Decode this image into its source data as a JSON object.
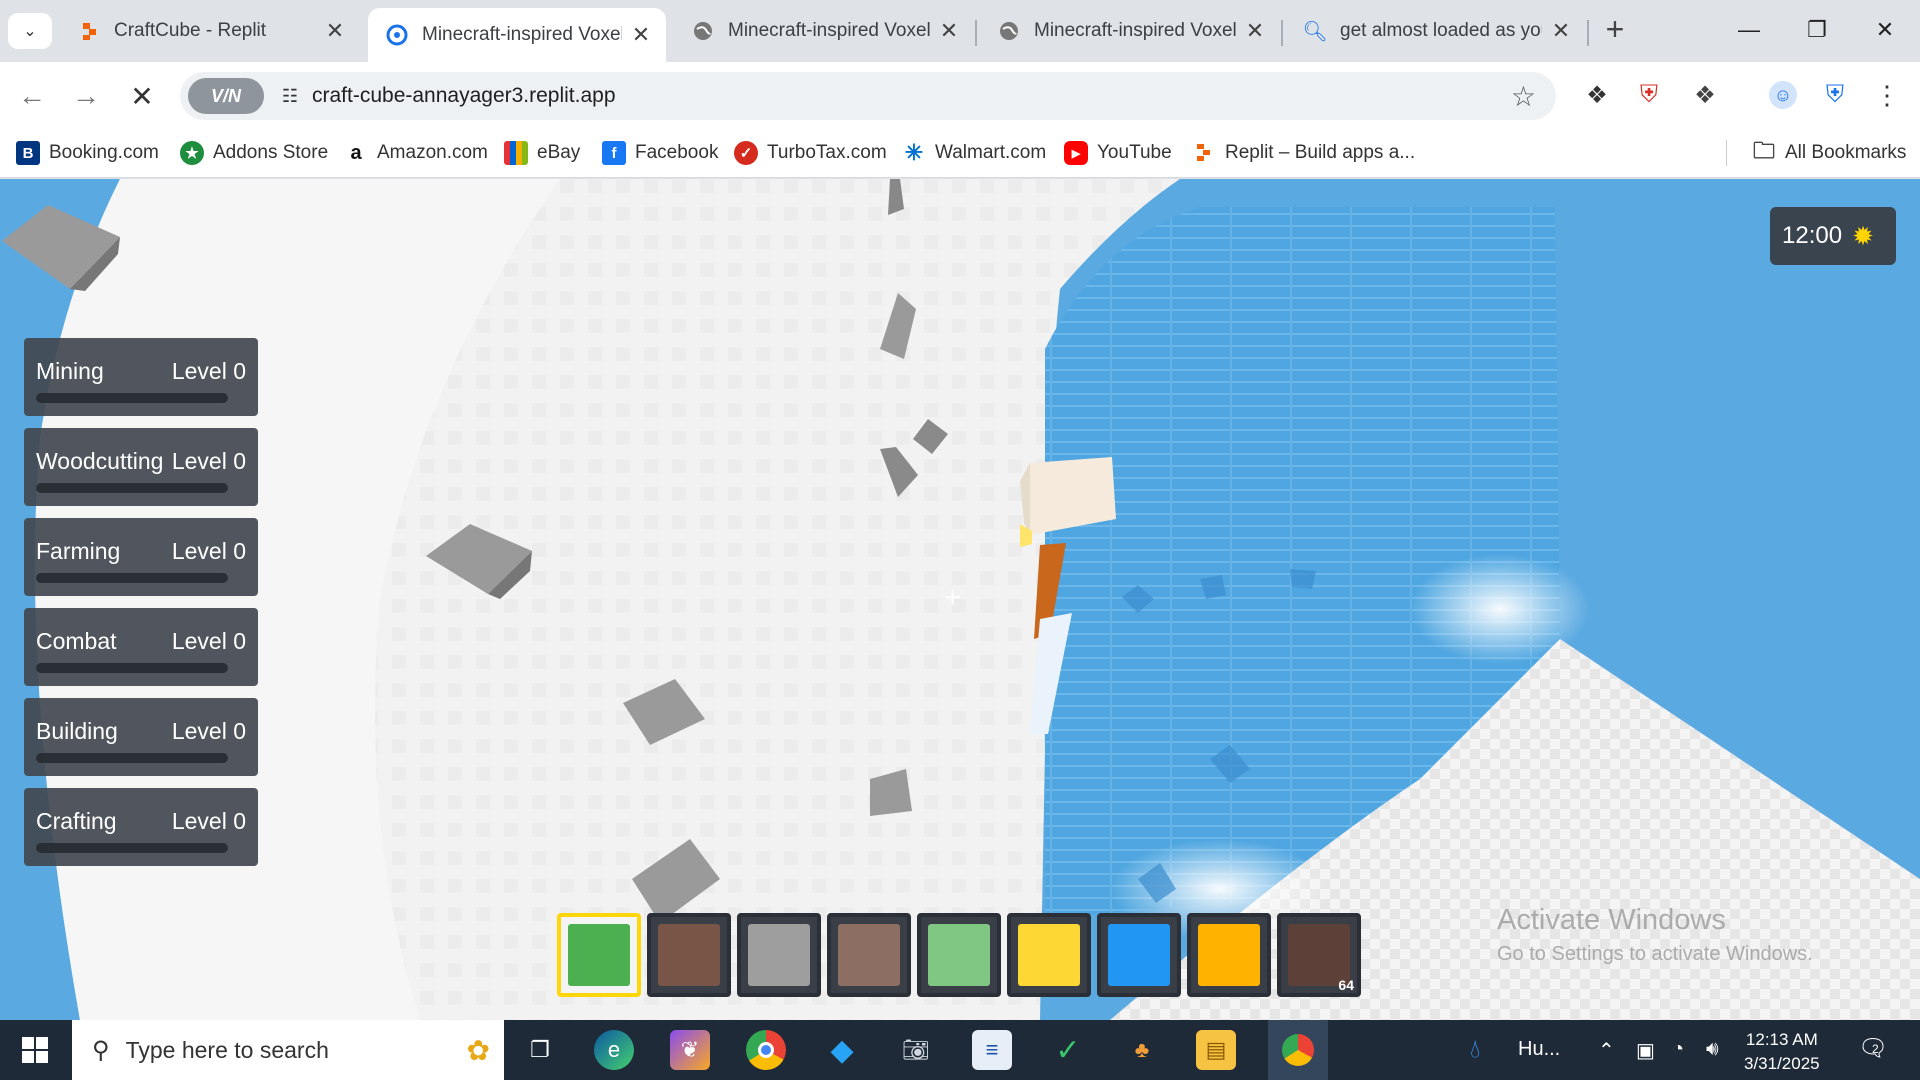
{
  "browser": {
    "tabs": [
      {
        "title": "CraftCube - Replit",
        "icon": "replit-icon",
        "active": false
      },
      {
        "title": "Minecraft-inspired Voxel",
        "icon": "replit-app-icon",
        "active": true
      },
      {
        "title": "Minecraft-inspired Voxel",
        "icon": "globe-icon",
        "active": false
      },
      {
        "title": "Minecraft-inspired Voxel",
        "icon": "globe-icon",
        "active": false
      },
      {
        "title": "get almost loaded as you",
        "icon": "search-icon",
        "active": false
      }
    ],
    "url": "craft-cube-annayager3.replit.app",
    "vpn_label": "V/N",
    "bookmarks": [
      {
        "label": "Booking.com",
        "icon": "booking-icon",
        "color": "#003580"
      },
      {
        "label": "Addons Store",
        "icon": "addons-icon",
        "color": "#1e8e3e"
      },
      {
        "label": "Amazon.com",
        "icon": "amazon-icon",
        "color": "#111111"
      },
      {
        "label": "eBay",
        "icon": "ebay-icon",
        "color": "#e53238"
      },
      {
        "label": "Facebook",
        "icon": "facebook-icon",
        "color": "#1877f2"
      },
      {
        "label": "TurboTax.com",
        "icon": "turbotax-icon",
        "color": "#d52b1e"
      },
      {
        "label": "Walmart.com",
        "icon": "walmart-icon",
        "color": "#0071ce"
      },
      {
        "label": "YouTube",
        "icon": "youtube-icon",
        "color": "#ff0000"
      },
      {
        "label": "Replit – Build apps a...",
        "icon": "replit-icon",
        "color": "#f26207"
      }
    ],
    "all_bookmarks": "All Bookmarks"
  },
  "game": {
    "skills": [
      {
        "name": "Mining",
        "level": "Level 0",
        "progress": 0
      },
      {
        "name": "Woodcutting",
        "level": "Level 0",
        "progress": 0
      },
      {
        "name": "Farming",
        "level": "Level 0",
        "progress": 0
      },
      {
        "name": "Combat",
        "level": "Level 0",
        "progress": 0
      },
      {
        "name": "Building",
        "level": "Level 0",
        "progress": 0
      },
      {
        "name": "Crafting",
        "level": "Level 0",
        "progress": 0
      }
    ],
    "time": "12:00",
    "time_icon": "sun-icon",
    "hotbar": [
      {
        "color": "#4caf50",
        "selected": true
      },
      {
        "color": "#795548",
        "selected": false
      },
      {
        "color": "#9e9e9e",
        "selected": false
      },
      {
        "color": "#8d6e63",
        "selected": false
      },
      {
        "color": "#81c784",
        "selected": false
      },
      {
        "color": "#fdd835",
        "selected": false
      },
      {
        "color": "#2196f3",
        "selected": false
      },
      {
        "color": "#ffb300",
        "selected": false
      },
      {
        "color": "#5d4037",
        "selected": false,
        "count": "64"
      }
    ],
    "watermark": {
      "line1": "Activate Windows",
      "line2": "Go to Settings to activate Windows."
    }
  },
  "taskbar": {
    "search_placeholder": "Type here to search",
    "weather": "Hu...",
    "time": "12:13 AM",
    "date": "3/31/2025",
    "notifications": "2"
  }
}
